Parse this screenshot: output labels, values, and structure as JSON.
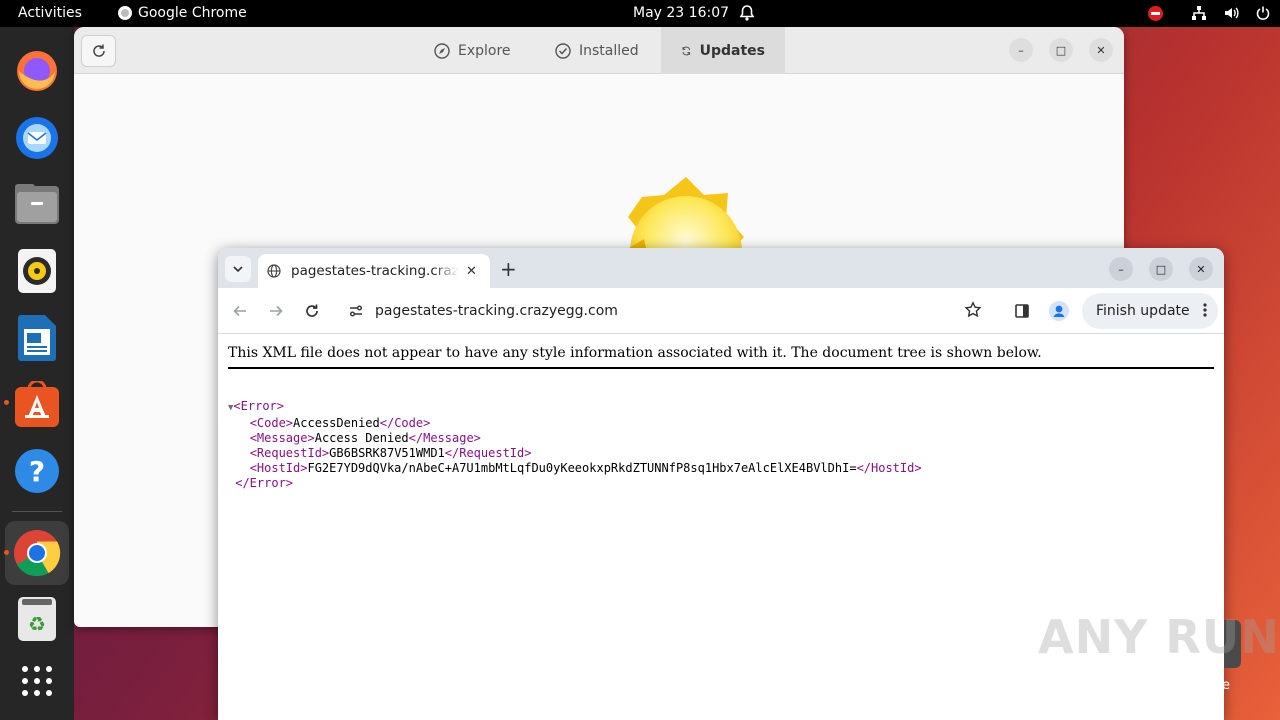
{
  "topbar": {
    "activities": "Activities",
    "app_name": "Google Chrome",
    "clock": "May 23  16:07"
  },
  "dock": {
    "items": [
      "firefox-icon",
      "thunderbird-icon",
      "files-icon",
      "rhythmbox-icon",
      "libreoffice-writer-icon",
      "app-center-icon",
      "help-icon",
      "chrome-icon",
      "trash-icon",
      "show-apps-icon"
    ]
  },
  "software_window": {
    "tabs": [
      {
        "label": "Explore",
        "icon": "compass-icon"
      },
      {
        "label": "Installed",
        "icon": "check-circle-icon"
      },
      {
        "label": "Updates",
        "icon": "sync-icon"
      }
    ],
    "active_tab": "Updates"
  },
  "chrome": {
    "tab_title": "pagestates-tracking.crazyegg.com",
    "url": "pagestates-tracking.crazyegg.com",
    "finish_update": "Finish update",
    "xml_notice": "This XML file does not appear to have any style information associated with it. The document tree is shown below.",
    "xml": {
      "root_open": "<Error>",
      "code_open": "<Code>",
      "code_value": "AccessDenied",
      "code_close": "</Code>",
      "message_open": "<Message>",
      "message_value": "Access Denied",
      "message_close": "</Message>",
      "requestid_open": "<RequestId>",
      "requestid_value": "GB6BSRK87V51WMD1",
      "requestid_close": "</RequestId>",
      "hostid_open": "<HostId>",
      "hostid_value": "FG2E7YD9dQVka/nAbeC+A7U1mbMtLqfDu0yKeeokxpRkdZTUNNfP8sq1Hbx7eAlcElXE4BVlDhI=",
      "hostid_close": "</HostId>",
      "root_close": "</Error>"
    }
  },
  "desktop": {
    "trash_label_fragment": "e",
    "watermark": "ANY RUN"
  },
  "colors": {
    "xml_tag": "#881280",
    "ubuntu_orange": "#e95420",
    "dnd_red": "#e01b24"
  }
}
